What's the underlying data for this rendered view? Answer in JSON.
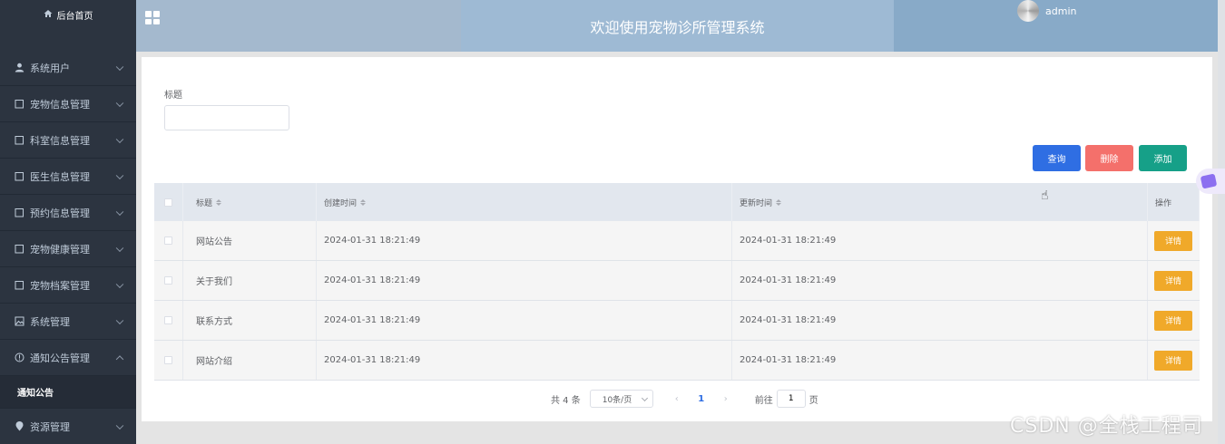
{
  "sidebar": {
    "home": "后台首页",
    "items": [
      {
        "label": "系统用户",
        "icon": "user-icon",
        "expanded": false
      },
      {
        "label": "宠物信息管理",
        "icon": "doc-icon",
        "expanded": false
      },
      {
        "label": "科室信息管理",
        "icon": "doc-icon",
        "expanded": false
      },
      {
        "label": "医生信息管理",
        "icon": "doc-icon",
        "expanded": false
      },
      {
        "label": "预约信息管理",
        "icon": "doc-icon",
        "expanded": false
      },
      {
        "label": "宠物健康管理",
        "icon": "doc-icon",
        "expanded": false
      },
      {
        "label": "宠物档案管理",
        "icon": "doc-icon",
        "expanded": false
      },
      {
        "label": "系统管理",
        "icon": "image-icon",
        "expanded": false
      },
      {
        "label": "通知公告管理",
        "icon": "info-icon",
        "expanded": true
      }
    ],
    "sub_item": "通知公告",
    "last_item": {
      "label": "资源管理",
      "icon": "location-icon"
    }
  },
  "header": {
    "title": "欢迎使用宠物诊所管理系统",
    "user": "admin"
  },
  "search": {
    "label": "标题",
    "value": "",
    "placeholder": ""
  },
  "toolbar": {
    "query": "查询",
    "delete": "删除",
    "add": "添加"
  },
  "table": {
    "columns": [
      "标题",
      "创建时间",
      "更新时间",
      "操作"
    ],
    "detail_label": "详情",
    "rows": [
      {
        "title": "网站公告",
        "created": "2024-01-31 18:21:49",
        "updated": "2024-01-31 18:21:49"
      },
      {
        "title": "关于我们",
        "created": "2024-01-31 18:21:49",
        "updated": "2024-01-31 18:21:49"
      },
      {
        "title": "联系方式",
        "created": "2024-01-31 18:21:49",
        "updated": "2024-01-31 18:21:49"
      },
      {
        "title": "网站介绍",
        "created": "2024-01-31 18:21:49",
        "updated": "2024-01-31 18:21:49"
      }
    ]
  },
  "pagination": {
    "total": "共 4 条",
    "page_size": "10条/页",
    "current_page": "1",
    "goto_label": "前往",
    "goto_value": "1",
    "page_unit": "页"
  },
  "watermark": "CSDN @全栈工程司",
  "colors": {
    "sidebar_bg": "#2c3440",
    "query": "#2f6ee3",
    "delete": "#f4706b",
    "add": "#16a088",
    "detail": "#f0a92a"
  }
}
